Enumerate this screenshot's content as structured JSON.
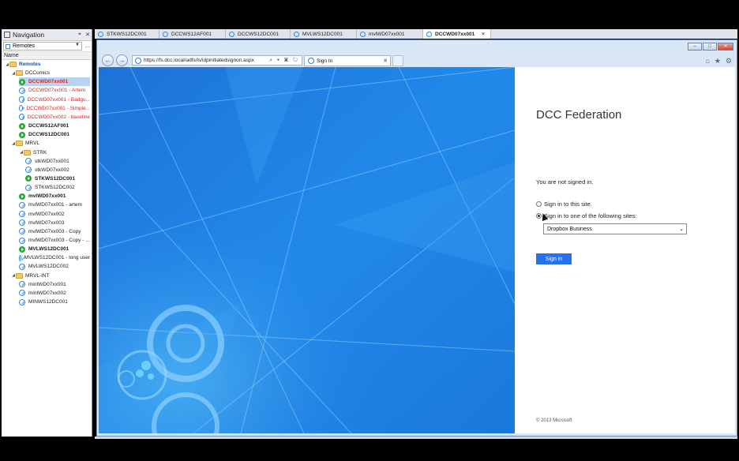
{
  "navigation": {
    "title": "Navigation",
    "pin_glyph": "⌖",
    "close_glyph": "✕",
    "source_select": "Remotes",
    "more_glyph": "…",
    "column_header": "Name"
  },
  "tree": [
    {
      "label": "Remotes",
      "level": 0,
      "icon": "folder",
      "style": "blue",
      "exp": "◢"
    },
    {
      "label": "DCComics",
      "level": 1,
      "icon": "folder",
      "style": "",
      "exp": "◢"
    },
    {
      "label": "DCCWD07xx001",
      "level": 2,
      "icon": "green",
      "style": "red bold",
      "selected": true
    },
    {
      "label": "DCCWD07xx001 - Artem",
      "level": 2,
      "icon": "edge",
      "style": "red"
    },
    {
      "label": "DCCWD07xx001 - Badgu...",
      "level": 2,
      "icon": "edge",
      "style": "red"
    },
    {
      "label": "DCCWD07xx001 - Simple...",
      "level": 2,
      "icon": "edge",
      "style": "red"
    },
    {
      "label": "DCCWD07xx002 - baseline",
      "level": 2,
      "icon": "edge",
      "style": "red"
    },
    {
      "label": "DCCWS12AF001",
      "level": 2,
      "icon": "green",
      "style": "bold"
    },
    {
      "label": "DCCWS12DC001",
      "level": 2,
      "icon": "green",
      "style": "bold"
    },
    {
      "label": "MRVL",
      "level": 1,
      "icon": "folder",
      "style": "",
      "exp": "◢"
    },
    {
      "label": "STRK",
      "level": 2,
      "icon": "folder",
      "style": "",
      "exp": "◢"
    },
    {
      "label": "stkWD07xx001",
      "level": 3,
      "icon": "edge",
      "style": ""
    },
    {
      "label": "stkWD07xx002",
      "level": 3,
      "icon": "edge",
      "style": ""
    },
    {
      "label": "STKWS12DC001",
      "level": 3,
      "icon": "green",
      "style": "bold"
    },
    {
      "label": "STKWS12DC002",
      "level": 3,
      "icon": "edge",
      "style": ""
    },
    {
      "label": "mvlWD07xx001",
      "level": 2,
      "icon": "green",
      "style": "bold"
    },
    {
      "label": "mvlWD07xx001 - artem",
      "level": 2,
      "icon": "edge",
      "style": ""
    },
    {
      "label": "mvlWD07xx002",
      "level": 2,
      "icon": "edge",
      "style": ""
    },
    {
      "label": "mvlWD07xx003",
      "level": 2,
      "icon": "edge",
      "style": ""
    },
    {
      "label": "mvlWD07xx003 - Copy",
      "level": 2,
      "icon": "edge",
      "style": ""
    },
    {
      "label": "mvlWD07xx003 - Copy - ...",
      "level": 2,
      "icon": "edge",
      "style": ""
    },
    {
      "label": "MVLWS12DC001",
      "level": 2,
      "icon": "green",
      "style": "bold"
    },
    {
      "label": "MVLWS12DC001 - long user",
      "level": 2,
      "icon": "edge",
      "style": ""
    },
    {
      "label": "MVLWS12DC002",
      "level": 2,
      "icon": "edge",
      "style": ""
    },
    {
      "label": "MRVL-INT",
      "level": 1,
      "icon": "folder",
      "style": "",
      "exp": "◢"
    },
    {
      "label": "mintWD07xx001",
      "level": 2,
      "icon": "edge",
      "style": ""
    },
    {
      "label": "mintWD07xx002",
      "level": 2,
      "icon": "edge",
      "style": ""
    },
    {
      "label": "MINWS12DC001",
      "level": 2,
      "icon": "edge",
      "style": ""
    }
  ],
  "session_tabs": [
    {
      "label": "STKWS12DC001",
      "active": false
    },
    {
      "label": "DCCWS12AF001",
      "active": false
    },
    {
      "label": "DCCWS12DC001",
      "active": false
    },
    {
      "label": "MVLWS12DC001",
      "active": false
    },
    {
      "label": "mvlWD07xx001",
      "active": false
    },
    {
      "label": "DCCWD07xx001",
      "active": true
    }
  ],
  "session_tab_close": "✕",
  "browser": {
    "back_glyph": "←",
    "forward_glyph": "→",
    "url": "https://fs.dcc.local/adfs/ls/idpinitiatedsignon.aspx",
    "url_tools": "⌕ ▾ ▣ ↻",
    "tab_title": "Sign In",
    "tab_close": "✕",
    "home_glyph": "⌂",
    "fav_glyph": "★",
    "settings_glyph": "⚙",
    "min_glyph": "–",
    "max_glyph": "□",
    "close_glyph": "✕"
  },
  "signin": {
    "title": "DCC Federation",
    "status": "You are not signed in.",
    "option_this_site": "Sign in to this site.",
    "option_other_sites": "Sign in to one of the following sites:",
    "selected_site": "Dropbox Business",
    "caret_glyph": "⌄",
    "button": "Sign in",
    "copyright": "© 2013 Microsoft"
  },
  "colors": {
    "accent": "#2672ec",
    "illustration_blue": "#1f7fe0",
    "red_text": "#e0201b"
  }
}
